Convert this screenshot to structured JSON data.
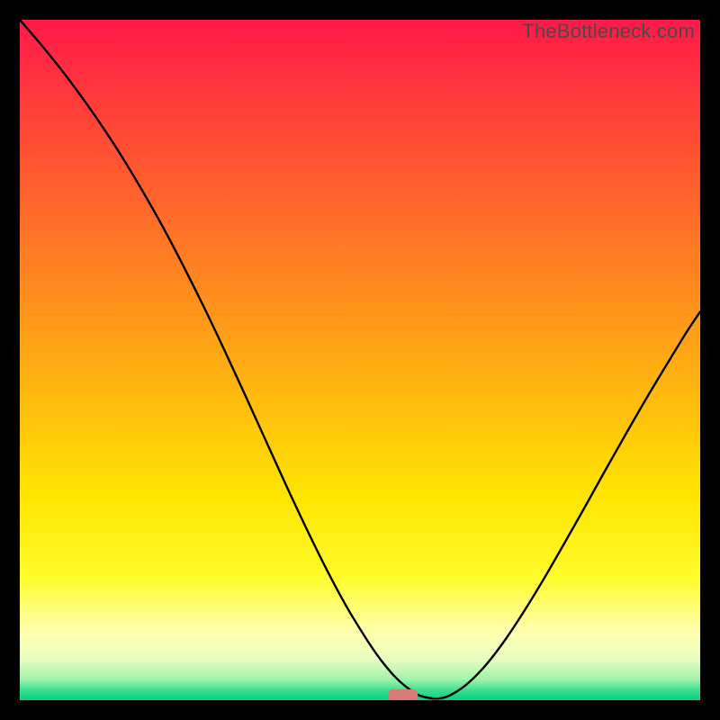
{
  "watermark": "TheBottleneck.com",
  "colors": {
    "background": "#000000",
    "curve_stroke": "#000000",
    "marker_fill": "#d77b74",
    "gradient_stops": [
      {
        "offset": 0.0,
        "color": "#ff1949"
      },
      {
        "offset": 0.1,
        "color": "#ff363d"
      },
      {
        "offset": 0.2,
        "color": "#ff5232"
      },
      {
        "offset": 0.3,
        "color": "#ff6f28"
      },
      {
        "offset": 0.4,
        "color": "#ff8c1e"
      },
      {
        "offset": 0.5,
        "color": "#ffaa14"
      },
      {
        "offset": 0.6,
        "color": "#ffc70a"
      },
      {
        "offset": 0.7,
        "color": "#ffe400"
      },
      {
        "offset": 0.82,
        "color": "#fffc2c"
      },
      {
        "offset": 0.9,
        "color": "#ffffb0"
      },
      {
        "offset": 0.94,
        "color": "#e9fcc0"
      },
      {
        "offset": 0.97,
        "color": "#9df3a8"
      },
      {
        "offset": 0.985,
        "color": "#3fe090"
      },
      {
        "offset": 1.0,
        "color": "#00d184"
      }
    ]
  },
  "chart_data": {
    "type": "line",
    "title": "",
    "xlabel": "",
    "ylabel": "",
    "xlim": [
      0,
      100
    ],
    "ylim": [
      0,
      100
    ],
    "x": [
      0,
      3,
      6,
      9,
      12,
      15,
      18,
      21,
      24,
      27,
      30,
      33,
      36,
      39,
      42,
      45,
      48,
      51,
      53,
      55,
      57,
      59,
      62,
      65,
      68,
      71,
      74,
      77,
      80,
      83,
      86,
      89,
      92,
      95,
      98,
      100
    ],
    "values": [
      100,
      96.5,
      92.8,
      88.8,
      84.5,
      79.9,
      74.9,
      69.6,
      63.9,
      57.9,
      51.6,
      45.1,
      38.5,
      31.9,
      25.5,
      19.4,
      13.8,
      8.9,
      6.0,
      3.6,
      1.8,
      0.6,
      0.3,
      1.8,
      4.6,
      8.4,
      12.9,
      17.8,
      23.0,
      28.3,
      33.7,
      39.0,
      44.2,
      49.2,
      54.1,
      57.1
    ],
    "marker": {
      "x": 56.3,
      "y": 0.6,
      "rx": 2.2,
      "ry": 1.0
    }
  }
}
